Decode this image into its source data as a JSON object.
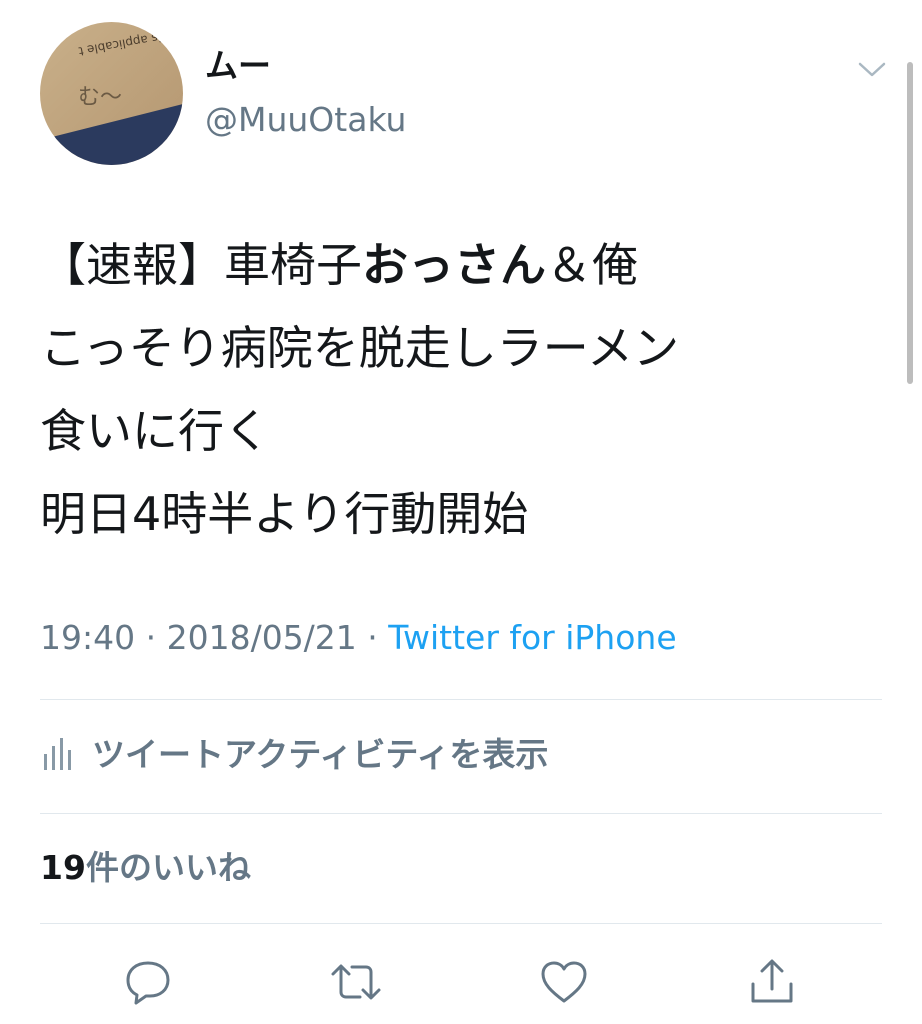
{
  "user": {
    "display_name": "ムー",
    "handle": "@MuuOtaku",
    "avatar_text": "む〜",
    "avatar_paper_text": "is applicable t"
  },
  "tweet": {
    "lines": [
      {
        "prefix": "【速報】車椅子",
        "bold": "おっさん",
        "suffix": "＆俺"
      },
      {
        "text": "こっそり病院を脱走しラーメン"
      },
      {
        "text": "食いに行く"
      },
      {
        "text": "明日4時半より行動開始"
      }
    ]
  },
  "meta": {
    "time": "19:40",
    "separator": " · ",
    "date": "2018/05/21",
    "source": "Twitter for iPhone"
  },
  "activity": {
    "label": "ツイートアクティビティを表示"
  },
  "likes": {
    "count": "19",
    "label": "件のいいね"
  },
  "icons": {
    "chevron": "chevron-down-icon",
    "activity": "bar-chart-icon",
    "reply": "reply-icon",
    "retweet": "retweet-icon",
    "like": "heart-icon",
    "share": "share-icon"
  },
  "colors": {
    "text": "#14171a",
    "secondary": "#657786",
    "link": "#1da1f2",
    "divider": "#e1e8ed"
  }
}
